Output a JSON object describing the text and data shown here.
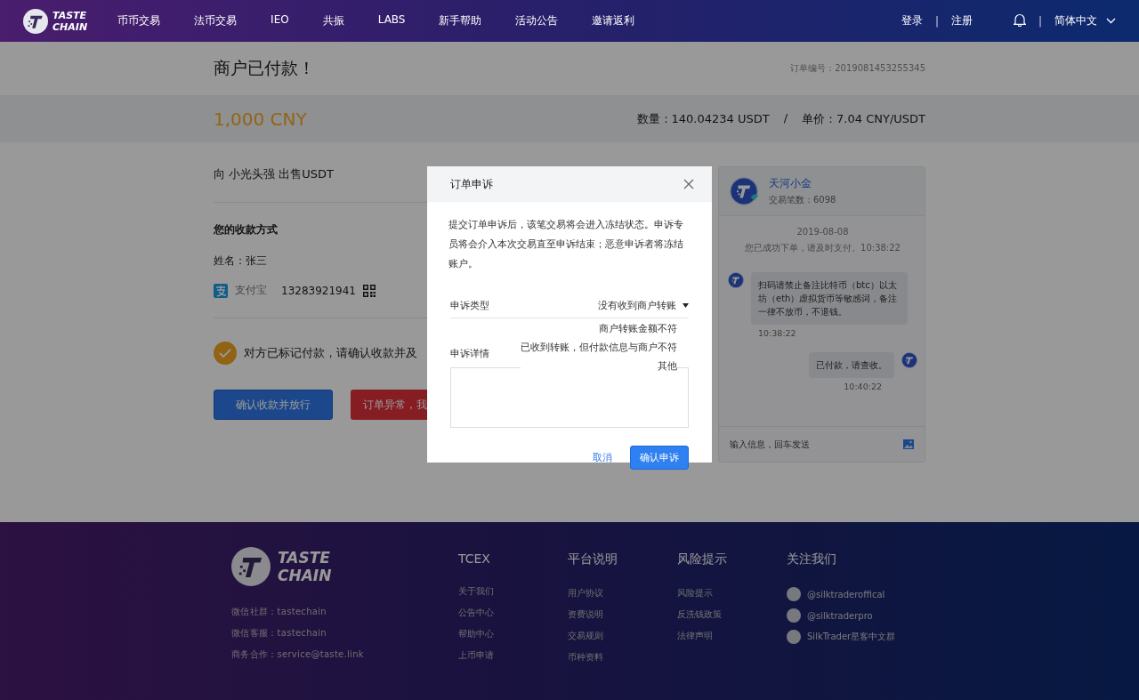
{
  "header": {
    "logo": [
      "TASTE",
      "CHAIN"
    ],
    "nav": [
      "币币交易",
      "法币交易",
      "IEO",
      "共振",
      "LABS",
      "新手帮助",
      "活动公告",
      "邀请返利"
    ],
    "login": "登录",
    "separator": "|",
    "register": "注册",
    "language": "简体中文"
  },
  "order": {
    "title": "商户已付款！",
    "order_no": "订单编号：2019081453255345",
    "amount": "1,000 CNY",
    "quantity": "数量：140.04234 USDT",
    "slash": "/",
    "price": "单价：7.04 CNY/USDT",
    "counterparty": "向 小光头强 出售USDT",
    "payment_heading": "您的收款方式",
    "name": "姓名：张三",
    "method": "支付宝",
    "account": "13283921941",
    "notice": "对方已标记付款，请确认收款并及",
    "buttons": [
      {
        "label": "确认收款并放行",
        "kind": "primary"
      },
      {
        "label": "订单异常，我",
        "kind": "danger"
      }
    ]
  },
  "chat": {
    "name": "天河小金",
    "trades": "交易笔数：6098",
    "date": "2019-08-08",
    "system": "您已成功下单，请及时支付。10:38:22",
    "messages": [
      {
        "outgoing": false,
        "text": "扫码请禁止备注比特币（btc）以太坊（eth）虚拟货币等敏感词，备注一律不放币，不退钱。",
        "time": "10:38:22"
      },
      {
        "outgoing": true,
        "text": "已付款，请查收。",
        "time": "10:40:22"
      }
    ],
    "input_placeholder": "输入信息，回车发送"
  },
  "dialog": {
    "title": "订单申诉",
    "description": "提交订单申诉后，该笔交易将会进入冻结状态。申诉专员将会介入本次交易直至申诉结束；恶意申诉者将冻结账户。",
    "appeal_type": {
      "label": "申诉类型",
      "value": "没有收到商户转账",
      "expanded": true,
      "options": [
        "商户转账金额不符",
        "已收到转账，但付款信息与商户不符",
        "其他"
      ]
    },
    "details_label": "申诉详情",
    "cancel": "取消",
    "confirm": "确认申诉"
  },
  "footer": {
    "logo": [
      "TASTE",
      "CHAIN"
    ],
    "contacts": [
      "微信社群：tastechain",
      "微信客服：tastechain",
      "商务合作：service@taste.link"
    ],
    "columns": [
      {
        "title": "TCEX",
        "links": [
          "关于我们",
          "公告中心",
          "帮助中心",
          "上币申请"
        ]
      },
      {
        "title": "平台说明",
        "links": [
          "用户协议",
          "资费说明",
          "交易规则",
          "币种资料"
        ]
      },
      {
        "title": "风险提示",
        "links": [
          "风险提示",
          "反洗钱政策",
          "法律声明"
        ]
      }
    ],
    "social": {
      "title": "关注我们",
      "links": [
        "@silktraderoffical",
        "@silktraderpro",
        "SilkTrader星客中文群"
      ]
    }
  }
}
